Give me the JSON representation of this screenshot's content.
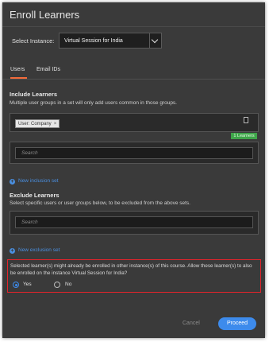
{
  "dialog": {
    "title": "Enroll Learners"
  },
  "instance": {
    "label": "Select Instance:",
    "value": "Virtual Session for India"
  },
  "tabs": [
    {
      "label": "Users",
      "active": true
    },
    {
      "label": "Email IDs",
      "active": false
    }
  ],
  "include": {
    "heading": "Include Learners",
    "description": "Multiple user groups in a set will only add users common in those groups.",
    "chip": "User: Company",
    "chip_close": "×",
    "learner_count": "1 Learners",
    "search_placeholder": "Search",
    "new_set_link": "New inclusion set"
  },
  "exclude": {
    "heading": "Exclude Learners",
    "description": "Select specific users or user groups below, to be excluded from the above sets.",
    "search_placeholder": "Search",
    "new_set_link": "New exclusion set"
  },
  "enroll_prompt": {
    "message": "Selected learner(s) might already be enrolled in other instance(s) of this course. Allow these learner(s) to also be enrolled on the instance Virtual Session for India?",
    "options": [
      {
        "label": "Yes",
        "selected": true
      },
      {
        "label": "No",
        "selected": false
      }
    ]
  },
  "footer": {
    "cancel_label": "Cancel",
    "proceed_label": "Proceed"
  },
  "colors": {
    "accent_blue": "#3d8bec",
    "tab_underline": "#f26b3a",
    "learners_badge": "#3fa54a",
    "highlight_border": "#e3242b"
  }
}
